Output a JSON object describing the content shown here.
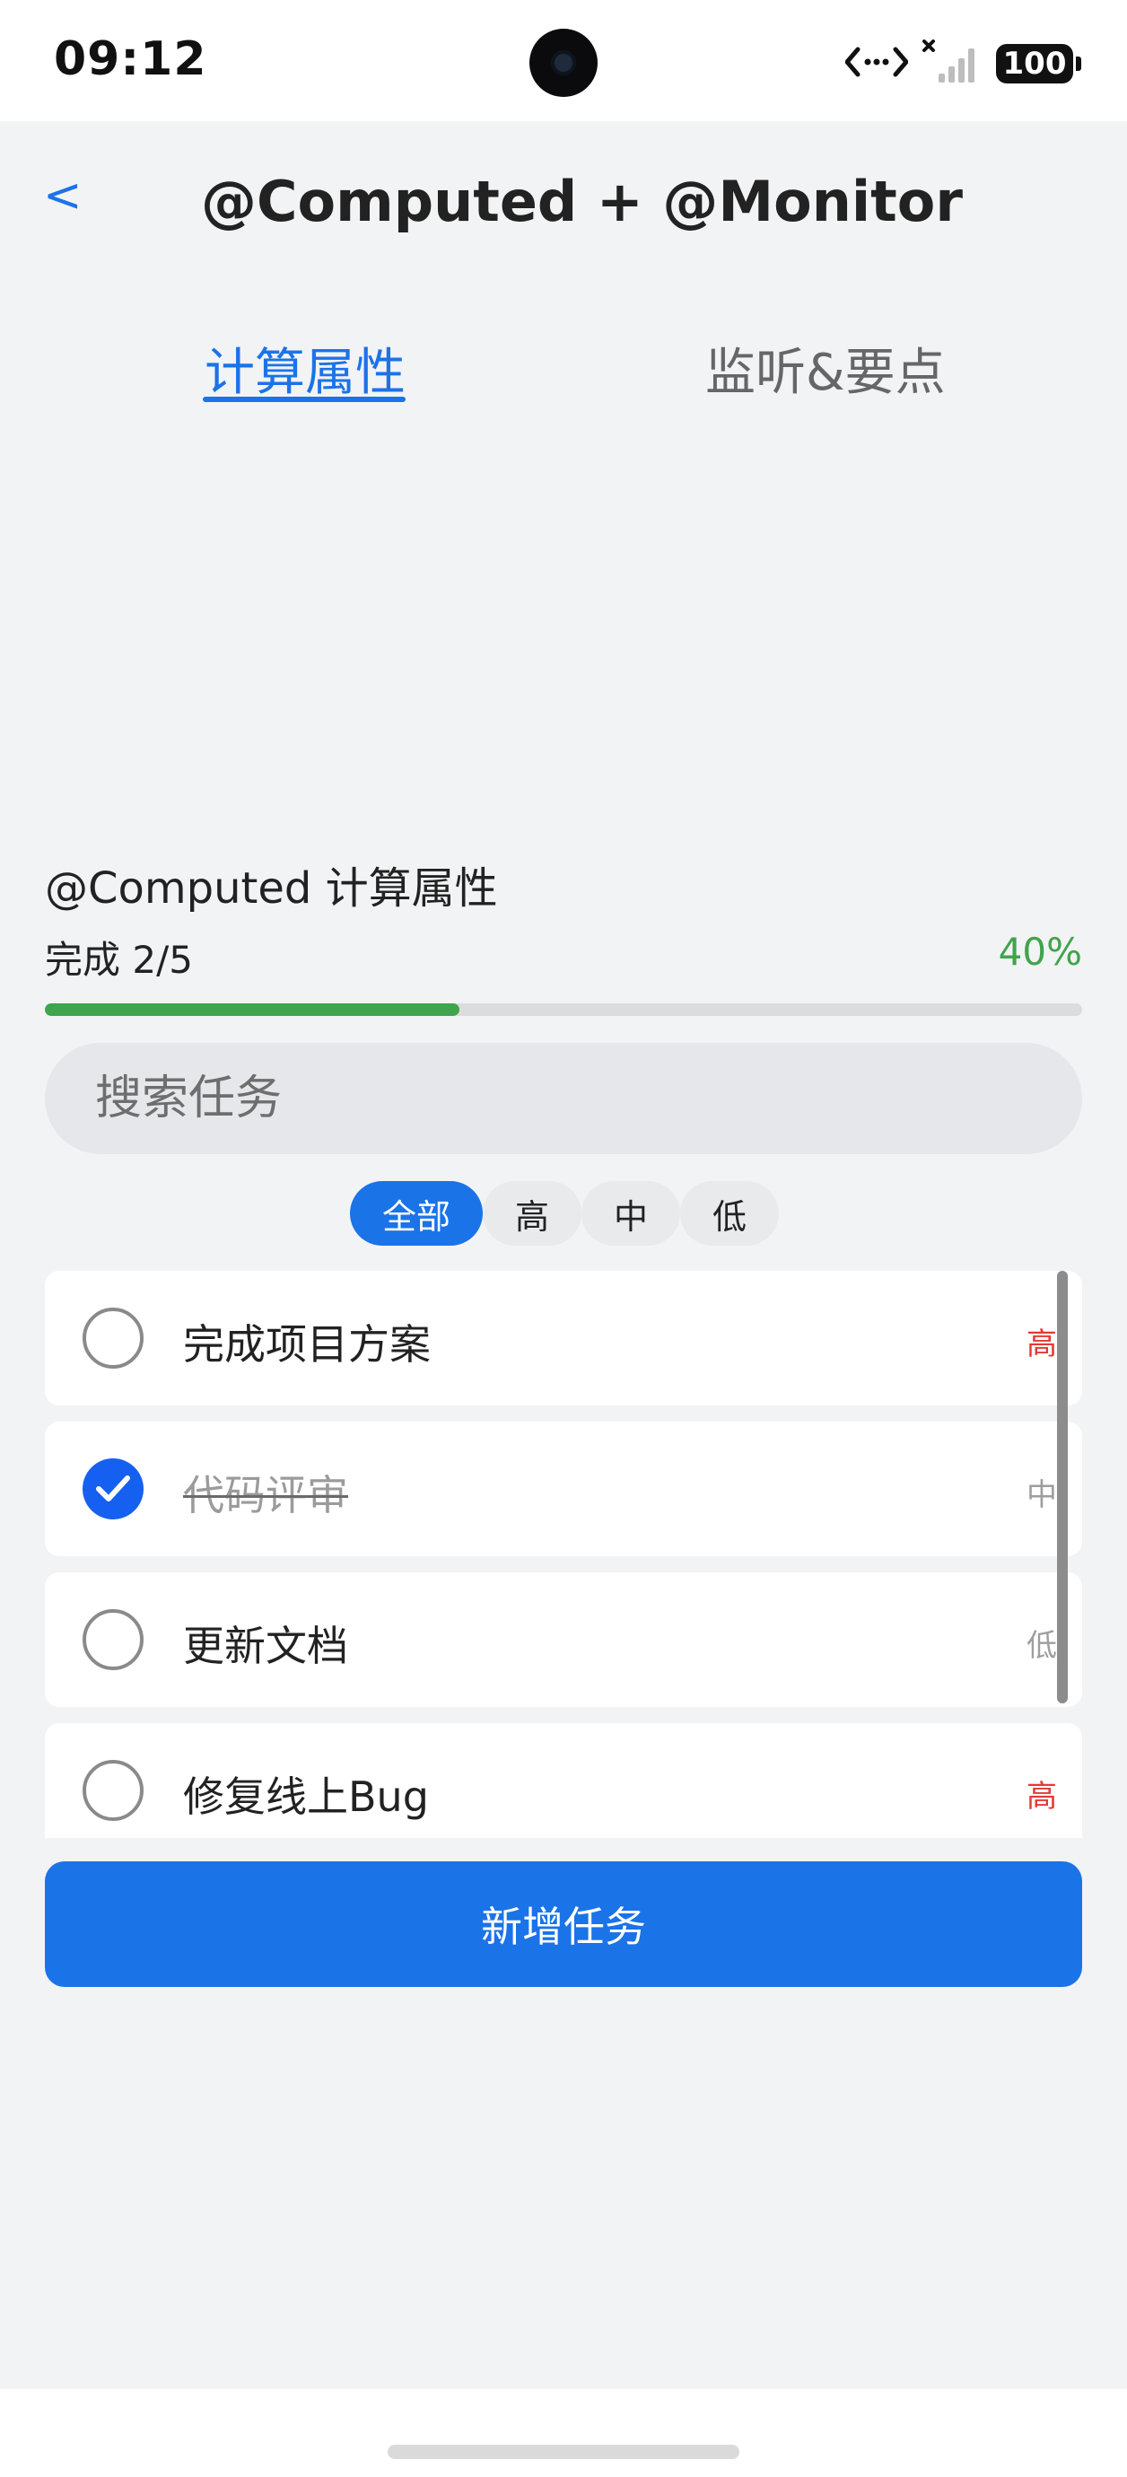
{
  "status_bar": {
    "time": "09:12",
    "battery": "100",
    "icons": [
      "data-transfer-icon",
      "no-sim-icon",
      "signal-icon",
      "battery-icon"
    ]
  },
  "header": {
    "back_label": "<",
    "title": "@Computed + @Monitor"
  },
  "tabs": [
    {
      "label": "计算属性",
      "active": true
    },
    {
      "label": "监听&要点",
      "active": false
    }
  ],
  "section": {
    "title": "@Computed 计算属性",
    "done_text": "完成 2/5",
    "percent_text": "40%",
    "progress_fraction": 0.4
  },
  "search": {
    "placeholder": "搜索任务",
    "value": ""
  },
  "filters": [
    {
      "label": "全部",
      "active": true
    },
    {
      "label": "高",
      "active": false
    },
    {
      "label": "中",
      "active": false
    },
    {
      "label": "低",
      "active": false
    }
  ],
  "tasks": [
    {
      "name": "完成项目方案",
      "done": false,
      "priority": "高",
      "priority_color": "#E53935"
    },
    {
      "name": "代码评审",
      "done": true,
      "priority": "中",
      "priority_color": "#9E9E9E"
    },
    {
      "name": "更新文档",
      "done": false,
      "priority": "低",
      "priority_color": "#9E9E9E"
    },
    {
      "name": "修复线上Bug",
      "done": false,
      "priority": "高",
      "priority_color": "#E53935"
    }
  ],
  "add_button": {
    "label": "新增任务"
  },
  "colors": {
    "accent": "#1B73E8",
    "progress": "#3FA44B",
    "high_priority": "#E53935",
    "check": "#1560F0"
  }
}
